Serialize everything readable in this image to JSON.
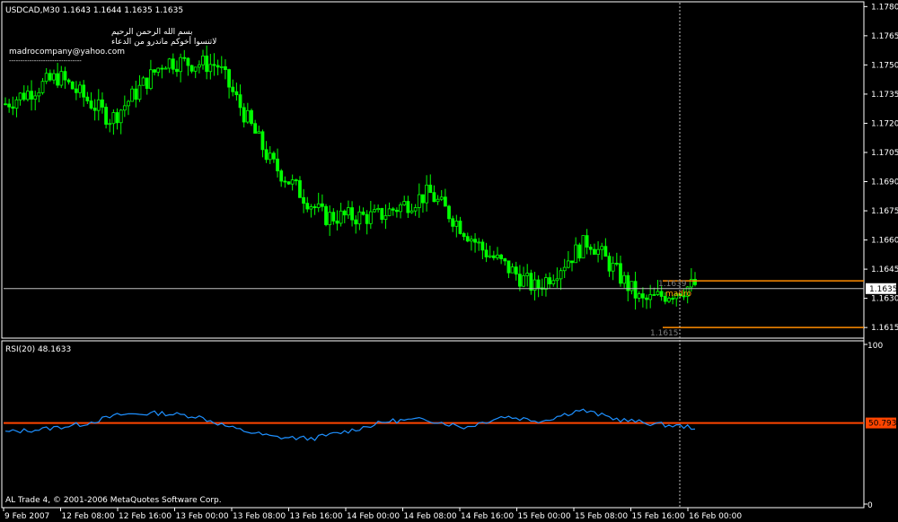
{
  "window": {
    "symbol_line": "USDCAD,M30  1.1643 1.1644 1.1635 1.1635",
    "comment_lines": [
      "بسم الله الرحمن الرحيم",
      "لاتنسوا أخوكم ماندرو من الدعاء",
      "madrocompany@yahoo.com",
      "--------------------------------"
    ],
    "copyright": "AL Trade 4, © 2001-2006 MetaQuotes Software Corp."
  },
  "colors": {
    "background": "#000000",
    "bull_candle": "#00ff00",
    "bear_candle": "#00ff00",
    "grid_line": "#c0c0c0",
    "level_line": "#ff8c00",
    "rsi_line": "#1e90ff",
    "rsi_level": "#ff4500",
    "cursor_line": "#c0c0c0",
    "label_madro": "#ffa500",
    "label_gray": "#808080"
  },
  "main_panel": {
    "current_price_tag": "1.1635",
    "y_ticks": [
      "1.1780",
      "1.1765",
      "1.1750",
      "1.1735",
      "1.1720",
      "1.1705",
      "1.1690",
      "1.1675",
      "1.1660",
      "1.1645",
      "1.1630",
      "1.1615"
    ],
    "annotations": {
      "upper_level_label": "1.1639",
      "lower_level_label": "1.1615",
      "madro_label": "madro"
    }
  },
  "rsi_panel": {
    "title": "RSI(20) 48.1633",
    "y_ticks": [
      "100",
      "0"
    ],
    "level_tag": "50.7937"
  },
  "x_axis": {
    "labels": [
      "9 Feb 2007",
      "12 Feb 08:00",
      "12 Feb 16:00",
      "13 Feb 00:00",
      "13 Feb 08:00",
      "13 Feb 16:00",
      "14 Feb 00:00",
      "14 Feb 08:00",
      "14 Feb 16:00",
      "15 Feb 00:00",
      "15 Feb 08:00",
      "15 Feb 16:00",
      "16 Feb 00:00"
    ]
  },
  "chart_data": [
    {
      "type": "line",
      "title": "USDCAD,M30",
      "xlabel": "",
      "ylabel": "",
      "ylim": [
        1.161,
        1.1782
      ],
      "grid": false,
      "x": [
        "9 Feb 2007",
        "12 Feb 08:00",
        "12 Feb 16:00",
        "13 Feb 00:00",
        "13 Feb 08:00",
        "13 Feb 16:00",
        "14 Feb 00:00",
        "14 Feb 08:00",
        "14 Feb 16:00",
        "15 Feb 00:00",
        "15 Feb 08:00",
        "15 Feb 16:00",
        "16 Feb 00:00"
      ],
      "series": [
        {
          "values": [
            1.173,
            1.1744,
            1.1722,
            1.1752,
            1.175,
            1.17,
            1.1672,
            1.1672,
            1.1684,
            1.1655,
            1.1635,
            1.166,
            1.1628,
            1.1637
          ]
        }
      ],
      "horizontal_levels": [
        1.1639,
        1.1615,
        1.1635
      ]
    },
    {
      "type": "line",
      "title": "RSI(20) 48.1633",
      "ylim": [
        0,
        100
      ],
      "series": [
        {
          "values": [
            45,
            47,
            50,
            56,
            57,
            55,
            47,
            42,
            41,
            46,
            52,
            53,
            48,
            55,
            52,
            59,
            53,
            50,
            48
          ]
        }
      ],
      "level": 50.7937
    }
  ]
}
